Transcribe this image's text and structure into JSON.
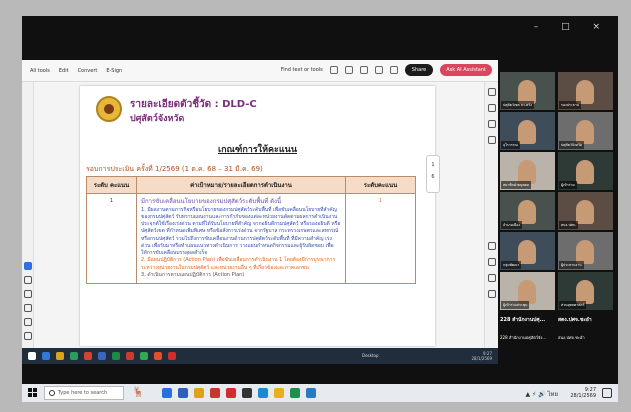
{
  "window": {
    "controls": [
      "–",
      "□",
      "×"
    ]
  },
  "pdf_toolbar": {
    "menu": [
      "All tools",
      "Edit",
      "Convert",
      "E-Sign"
    ],
    "find": "Find text or tools",
    "share_label": "Share",
    "ai_label": "Ask AI Assistant"
  },
  "document": {
    "title": "รายละเอียดตัวชี้วัด : DLD-C",
    "subtitle": "ปศุสัตว์จังหวัด",
    "criteria_heading": "เกณฑ์การให้คะแนน",
    "round": "รอบการประเมิน ครั้งที่ 1/2569 (1 ต.ค. 68 – 31 มี.ค. 69)",
    "table": {
      "headers": [
        "ระดับ คะแนน",
        "ค่าเป้าหมาย/รายละเอียดการดำเนินงาน",
        "ระดับคะแนน"
      ],
      "level": "1",
      "item_title": "มีการขับเคลื่อนนโยบายของกรมปศุสัตว์ระดับพื้นที่ ดังนี้",
      "sub1": "1. มีผลงานตามภารกิจหรือนโยบายของกรมปศุสัตว์ระดับพื้นที่ เพื่อขับเคลื่อนนโยบายที่สำคัญของกรมปศุสัตว์ รับทราบแผนงานและการกำกับของแต่ละหน่วยงานตัดตามผลการดำเนินงานประจุกต์ใช้เรื่องเร่งด่วน ตามที่ได้รับนโยบายที่สำคัญ จากอธิบดีกรมปศุสัตว์ หรือรองอธิบดี หรือ ปศุสัตว์เขต ที่กำหนดเพิ่มพิเศษ หรือข้อสั่งการเร่งด่วน จากรัฐบาล กระทรวงเกษตรและสหกรณ์ หรือกรมปศุสัตว์ รวมไปถึงการขับเคลื่อนงานด้านการปศุสัตว์ระดับพื้นที่ ที่มีความสำคัญ เร่งด่วน เพื่อรับมาหรือทำแผนแนวทางดำเนินการ วางแผนกำหนดกิจกรรมและผู้รับผิดชอบ เพื่อให้การขับเคลื่อนบรรลุผลสำเร็จ",
      "sub2": "2. มีแผนปฏิบัติการ (Action Plan) เพื่อขับเคลื่อนการดำเนินงาน 1 โดยต้องมีการบูรณาการระหว่างหน่วยงานในกรมปศุสัตว์ และหน่วยงานอื่น ๆ ที่เกี่ยวข้องและภาคเอกชน",
      "sub3": "3. ดำเนินการตามแผนปฏิบัติการ (Action Plan)",
      "score": "1"
    },
    "page_controls": [
      "1",
      "6"
    ]
  },
  "remote_taskbar": {
    "desktop_label": "Desktop",
    "time": "9:27",
    "date": "28/1/2569"
  },
  "participants": [
    {
      "name": "ปศุสัตว์เขต สว.ตรัง"
    },
    {
      "name": "รองประธาน"
    },
    {
      "name": "อุไรวรรณ"
    },
    {
      "name": "ปศุสัตว์จังหวัด"
    },
    {
      "name": "สมาชิกฝ่ายบุคคล"
    },
    {
      "name": "ผู้เข้าร่วม"
    },
    {
      "name": "อำเภอเมือง"
    },
    {
      "name": "สนง.ปศจ."
    },
    {
      "name": "กลุ่มพัฒนา"
    },
    {
      "name": "ผู้ประสานงาน"
    },
    {
      "name": "ผู้เข้าร่วมประชุม"
    },
    {
      "name": "ส่วนยุทธศาสตร์"
    },
    {
      "name": "228 สำนักงานปศุ..."
    },
    {
      "name": "สตง.ปศจ.ชะอำ"
    }
  ],
  "participant_labels": {
    "main_left": "228 สำนักงานปศุ...",
    "main_right": "สตง.ปศจ.ชะอำ",
    "sub_left": "228 สำนักงานปศุสัตว์จัง...",
    "sub_right": "สนง.ปศจ.ชะอำ"
  },
  "taskbar": {
    "search_placeholder": "Type here to search",
    "time": "9:27",
    "date": "28/1/2569",
    "lang": "ไทย"
  },
  "colors": {
    "title": "#7a2f7a",
    "round": "#b0501e",
    "header_bg": "#f6dcc7",
    "share_button": "#1b1b1b",
    "ai_button": "#d9475f"
  }
}
